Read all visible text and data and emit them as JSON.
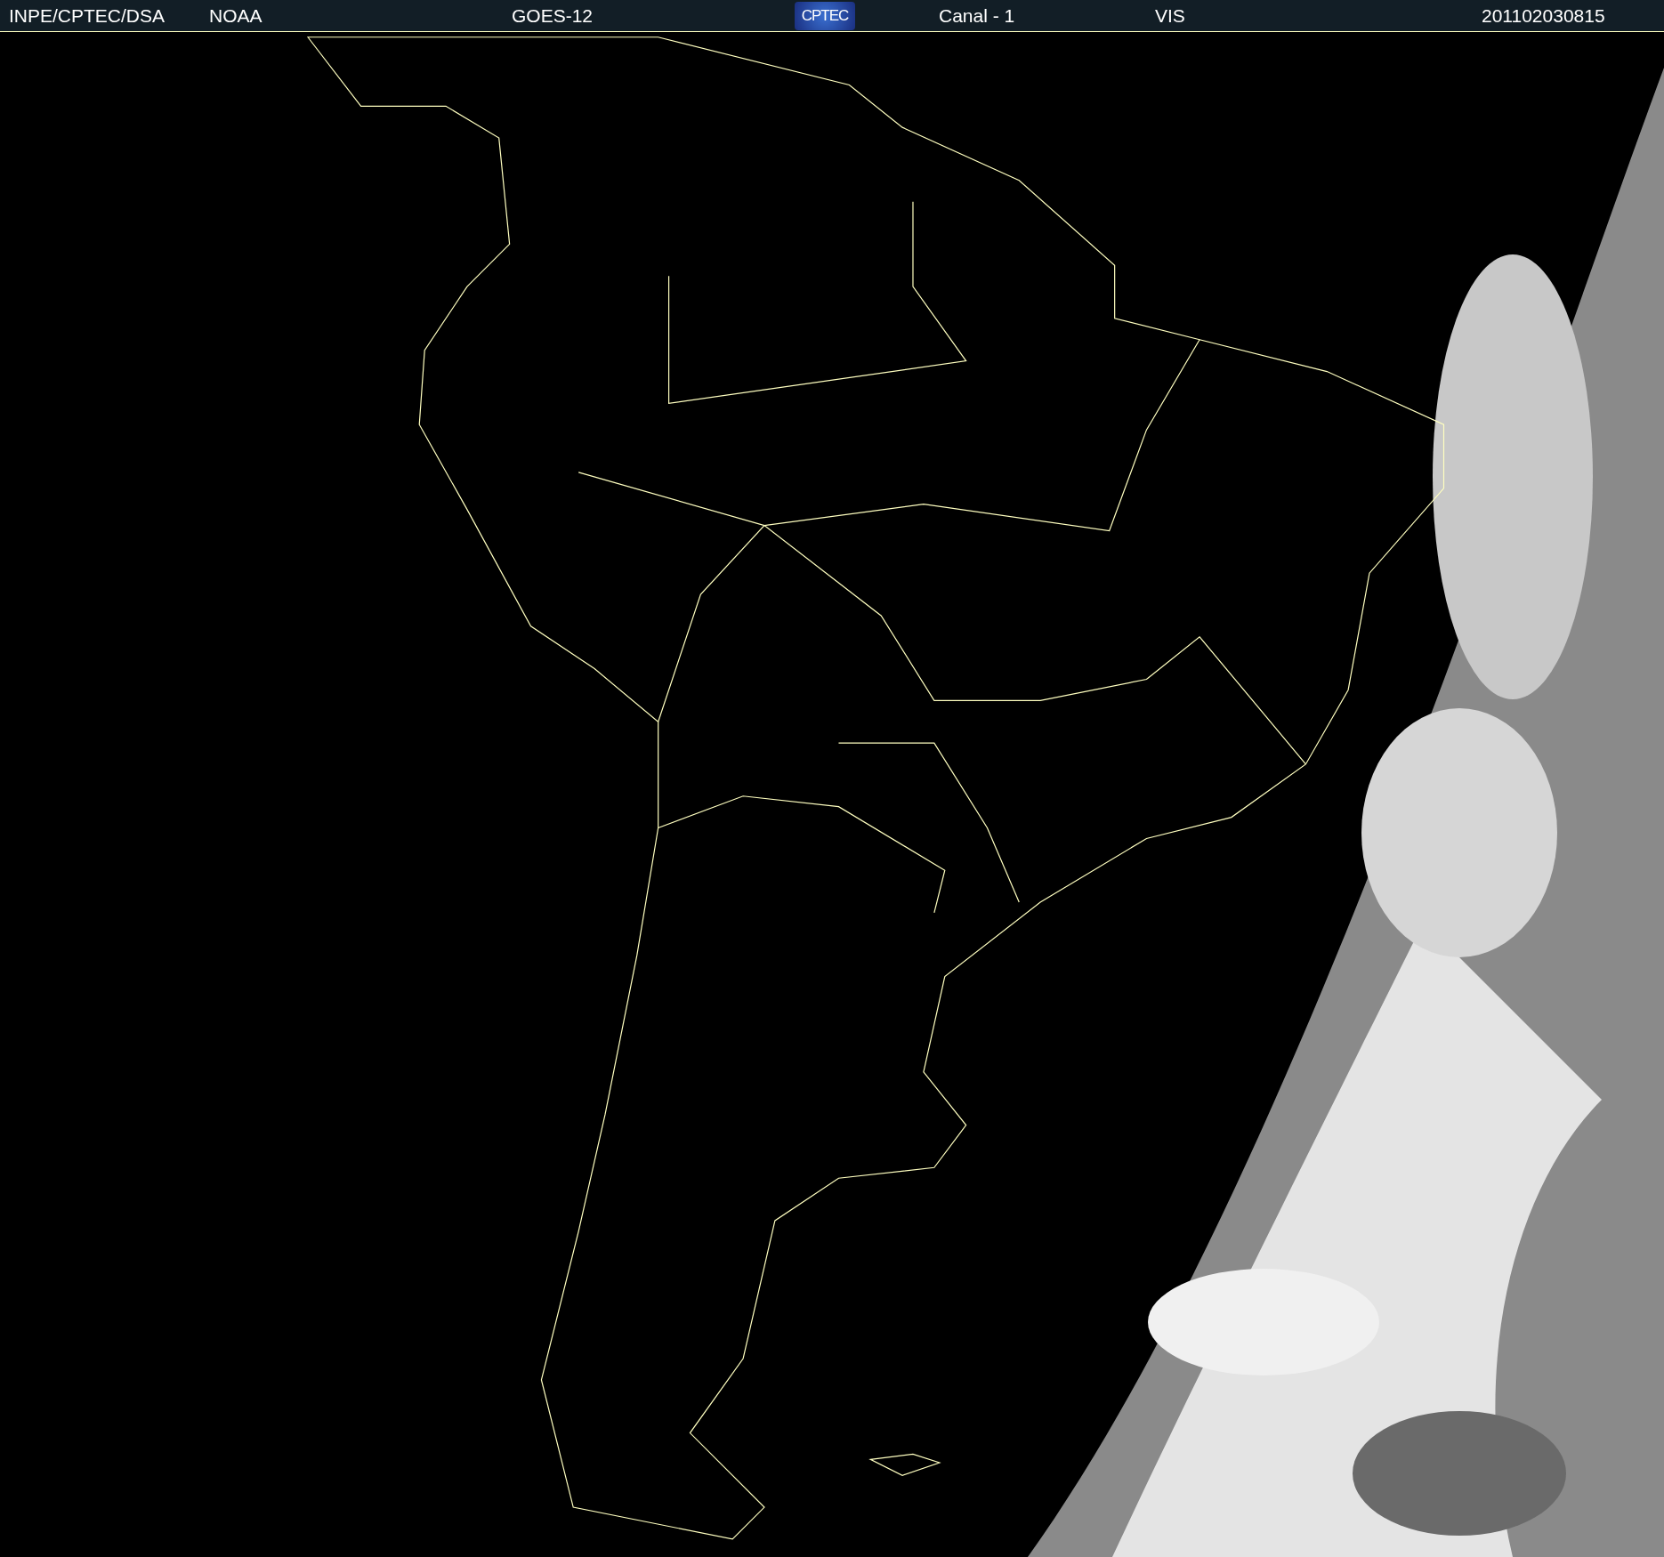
{
  "header": {
    "items": [
      {
        "kind": "text",
        "text": "INPE/CPTEC/DSA"
      },
      {
        "kind": "text",
        "text": "NOAA"
      },
      {
        "kind": "text",
        "text": "GOES-12"
      },
      {
        "kind": "logo",
        "text": "CPTEC"
      },
      {
        "kind": "text",
        "text": "Canal - 1"
      },
      {
        "kind": "text",
        "text": "VIS"
      },
      {
        "kind": "text",
        "text": "201102030815"
      }
    ]
  }
}
